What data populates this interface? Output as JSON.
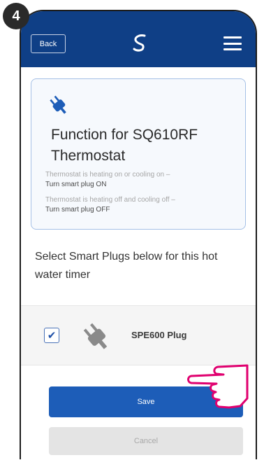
{
  "step": {
    "number": "4"
  },
  "header": {
    "back_label": "Back",
    "logo_icon": "salus-s-logo-icon",
    "menu_icon": "hamburger-menu-icon",
    "background_color": "#0f3f86"
  },
  "function_card": {
    "icon": "plug-icon",
    "title_line1": "Function for SQ610RF",
    "title_line2": "Thermostat",
    "rule1_condition": "Thermostat is heating on or cooling on –",
    "rule1_action": "Turn smart plug ON",
    "rule2_condition": "Thermostat is heating off and cooling off –",
    "rule2_action": "Turn smart plug OFF"
  },
  "instruction": {
    "line1": "Select Smart Plugs below for this hot",
    "line2": "water timer"
  },
  "plug_list": [
    {
      "name": "SPE600 Plug",
      "checked": true,
      "icon": "plug-icon"
    }
  ],
  "actions": {
    "save_label": "Save",
    "cancel_label": "Cancel",
    "save_color": "#1d5db8"
  },
  "overlay": {
    "icon": "pointing-hand-icon",
    "color": "#e0006f"
  }
}
